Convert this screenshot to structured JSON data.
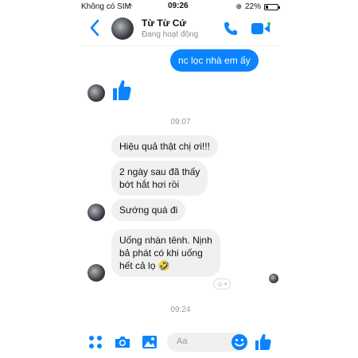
{
  "status_bar": {
    "carrier": "Không có SIM",
    "time": "09:26",
    "battery": "22%",
    "battery_level": 0.22
  },
  "header": {
    "contact_name": "Từ Từ Cứ",
    "presence": "Đang hoạt động",
    "icons": [
      "back-icon",
      "phone-icon",
      "video-call-icon"
    ]
  },
  "conversation": {
    "outgoing_1": "nc lọc nhà em ấy",
    "timestamps": [
      "09:07",
      "09:24"
    ],
    "incoming": [
      "Hiệu quả thật chị ơi!!!",
      "2 ngày sau đã thấy\nbớt hắt hơi rồi",
      "Sướng quá đi",
      "Uống nhàn tênh. Nịnh\nbả phát có khi uống\nhết cả lọ 🤣"
    ]
  },
  "composer": {
    "placeholder": "Aa",
    "icons": [
      "menu-dots-icon",
      "camera-icon",
      "gallery-icon",
      "mic-icon",
      "emoji-icon",
      "like-icon"
    ]
  },
  "colors": {
    "accent": "#0a84ff",
    "incoming_bubble": "#f0f0f0"
  }
}
